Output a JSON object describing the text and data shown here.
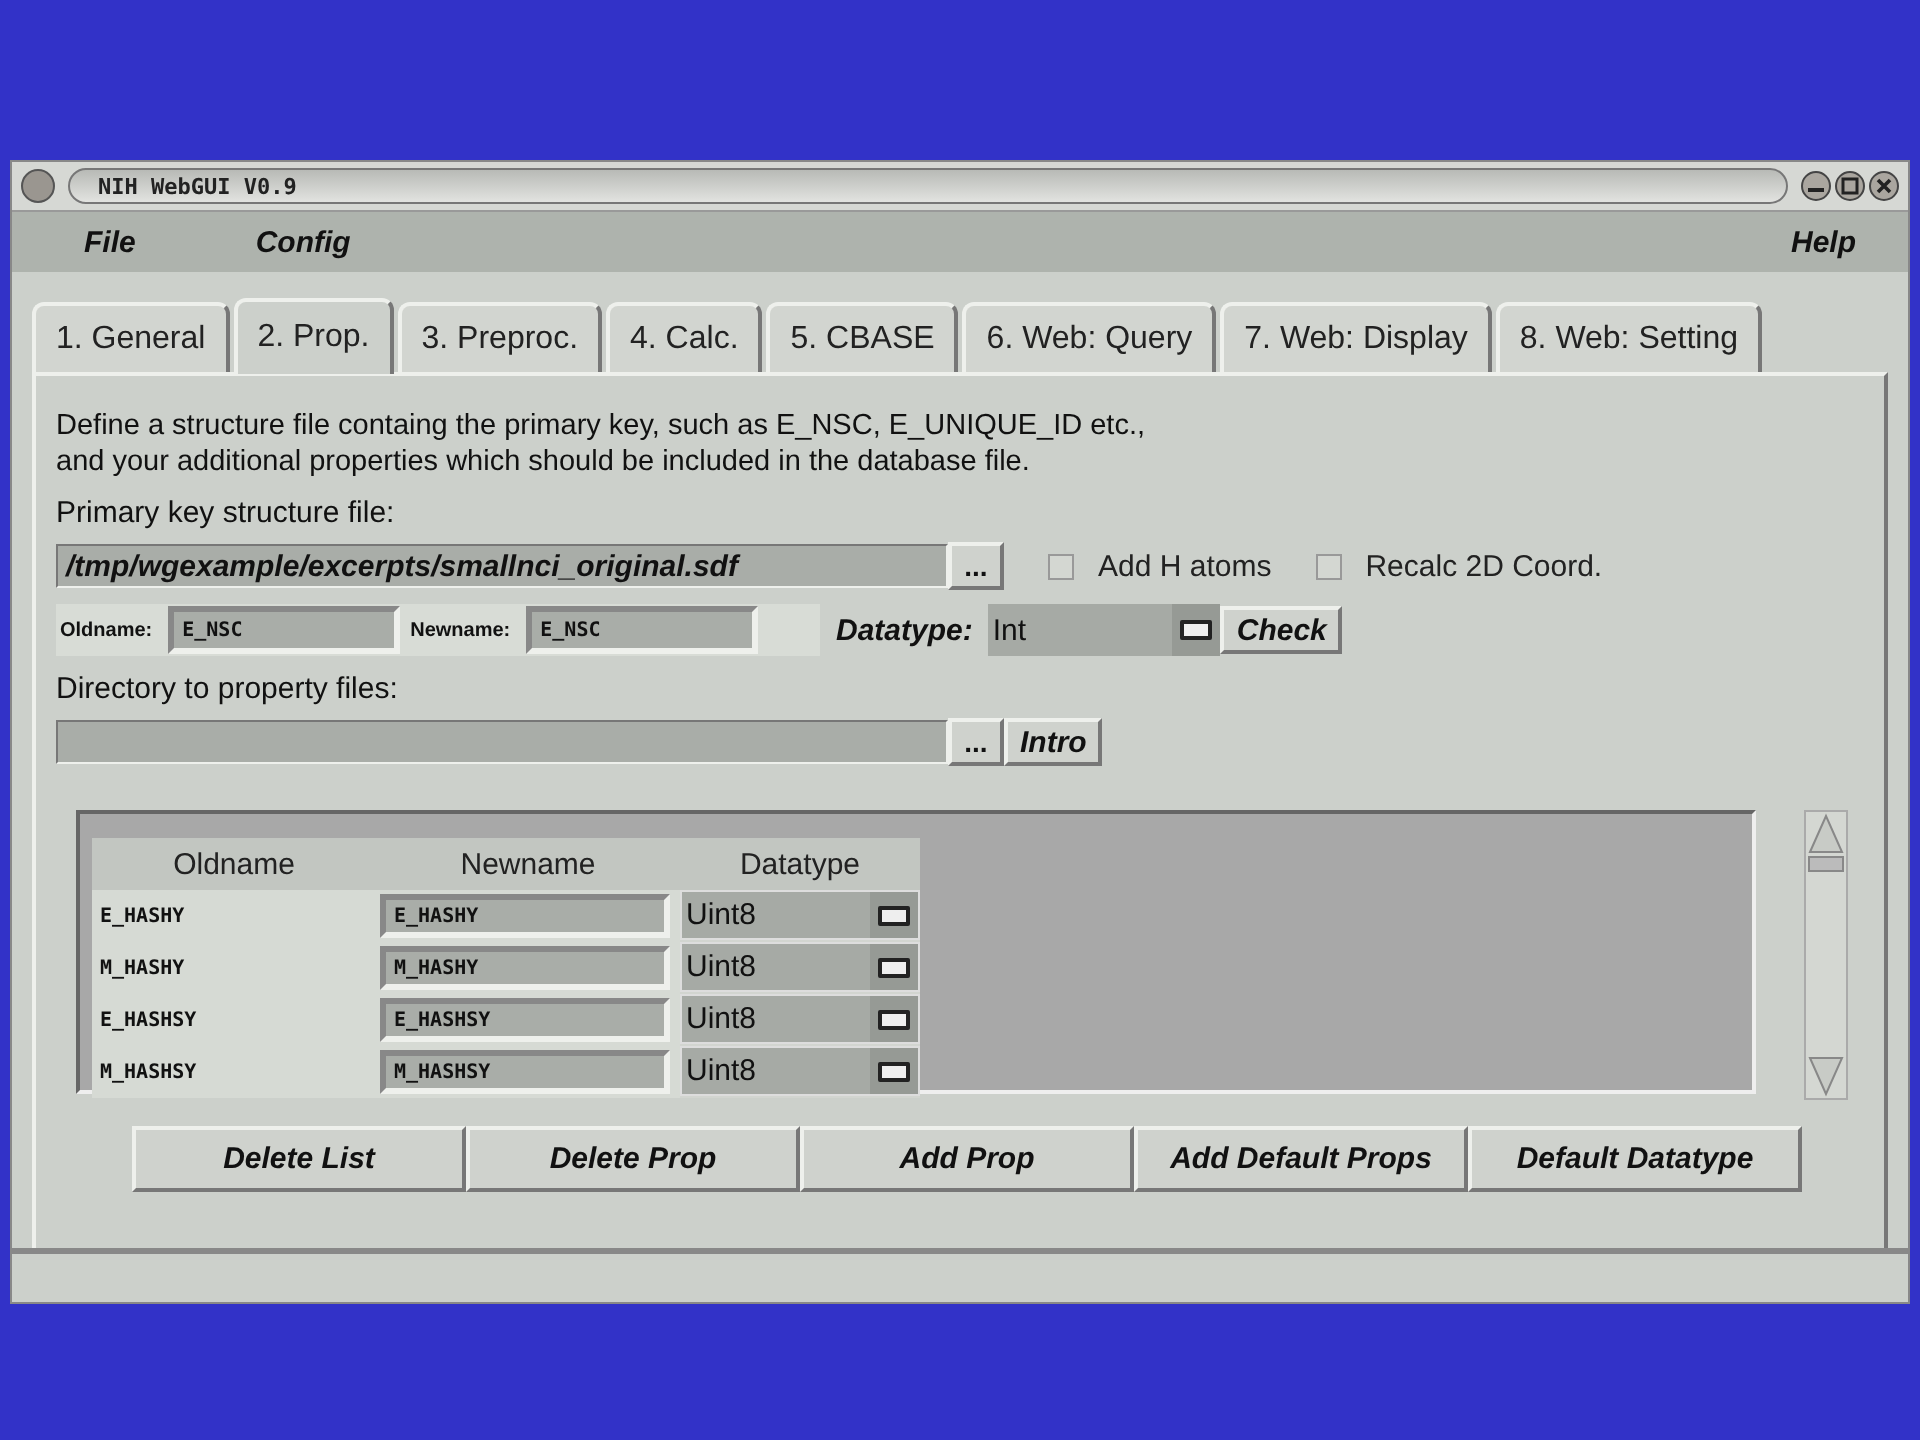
{
  "window": {
    "title": "NIH WebGUI V0.9"
  },
  "menu": [
    {
      "label": "File"
    },
    {
      "label": "Config"
    },
    {
      "label": "Help"
    }
  ],
  "tabs": [
    {
      "label": "1. General",
      "selected": false
    },
    {
      "label": "2. Prop.",
      "selected": true
    },
    {
      "label": "3. Preproc.",
      "selected": false
    },
    {
      "label": "4. Calc.",
      "selected": false
    },
    {
      "label": "5. CBASE",
      "selected": false
    },
    {
      "label": "6. Web: Query",
      "selected": false
    },
    {
      "label": "7. Web: Display",
      "selected": false
    },
    {
      "label": "8. Web: Setting",
      "selected": false
    }
  ],
  "description": "Define a structure file containg the primary key, such as E_NSC, E_UNIQUE_ID etc.,\nand your additional properties which should be included in the database file.",
  "primary_key": {
    "label": "Primary key structure file:",
    "value": "/tmp/wgexample/excerpts/smallnci_original.sdf",
    "browse": "...",
    "options": [
      {
        "label": "Add H atoms",
        "checked": false
      },
      {
        "label": "Recalc 2D Coord.",
        "checked": false
      }
    ]
  },
  "key_row": {
    "oldname_label": "Oldname:",
    "oldname": "E_NSC",
    "newname_label": "Newname:",
    "newname": "E_NSC",
    "datatype_label": "Datatype:",
    "datatype": "Int",
    "check_button": "Check"
  },
  "directory": {
    "label": "Directory to property files:",
    "browse": "...",
    "intro_button": "Intro"
  },
  "table": {
    "columns": [
      "Oldname",
      "Newname",
      "Datatype"
    ],
    "rows": [
      {
        "oldname": "E_HASHY",
        "newname": "E_HASHY",
        "datatype": "Uint8"
      },
      {
        "oldname": "M_HASHY",
        "newname": "M_HASHY",
        "datatype": "Uint8"
      },
      {
        "oldname": "E_HASHSY",
        "newname": "E_HASHSY",
        "datatype": "Uint8"
      },
      {
        "oldname": "M_HASHSY",
        "newname": "M_HASHSY",
        "datatype": "Uint8"
      }
    ]
  },
  "buttons": [
    "Delete List",
    "Delete Prop",
    "Add Prop",
    "Add Default Props",
    "Default Datatype"
  ]
}
